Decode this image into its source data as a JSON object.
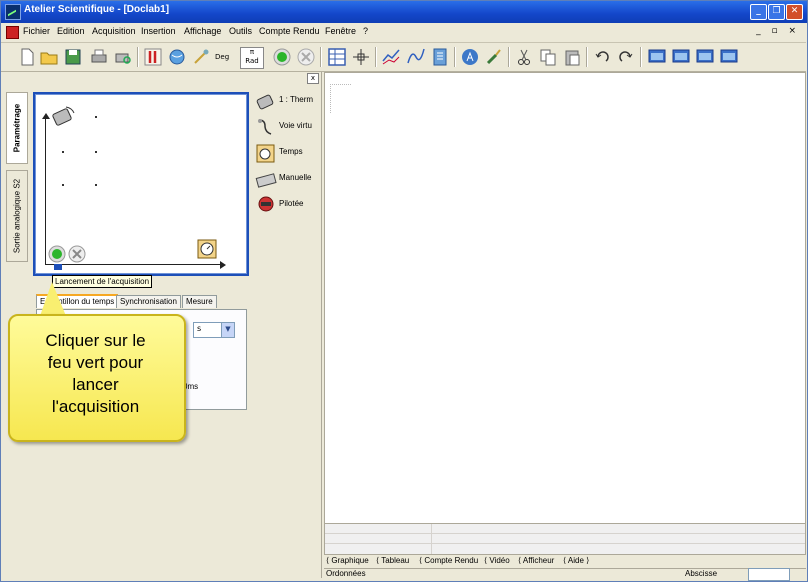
{
  "window": {
    "title": "Atelier Scientifique - [Doclab1]",
    "controls": [
      "_",
      "❐",
      "✕"
    ]
  },
  "menu": {
    "items": [
      "Fichier",
      "Edition",
      "Acquisition",
      "Insertion",
      "Affichage",
      "Outils",
      "Compte Rendu",
      "Fenêtre",
      "?"
    ],
    "mdi_controls": "_ ▫ ×"
  },
  "toolbar": {
    "deg_label": "Deg",
    "rad_label": "Rad",
    "pi_label": "π",
    "icons": [
      "new-icon",
      "open-icon",
      "save-icon",
      "print-icon",
      "print-preview-icon",
      "sensor-icon",
      "globe-icon",
      "wand-icon",
      "deg-icon",
      "rad-icon",
      "green-light-icon",
      "stop-icon",
      "table-icon",
      "cross-cursor-icon",
      "chart-icon",
      "curve-icon",
      "notebook-icon",
      "font-icon",
      "brush-icon",
      "cut-icon",
      "copy-icon",
      "paste-icon",
      "undo-icon",
      "redo-icon",
      "window1-icon",
      "window2-icon",
      "window3-icon",
      "window4-icon"
    ]
  },
  "left_panel": {
    "close_label": "x",
    "vertical_tabs": [
      "Paramétrage",
      "Sortie analogique S2"
    ],
    "sources": [
      {
        "label": "1 : Therm",
        "icon": "thermometer-sensor-icon"
      },
      {
        "label": "Voie virtu",
        "icon": "virtual-channel-icon"
      },
      {
        "label": "Temps",
        "icon": "stopwatch-icon"
      },
      {
        "label": "Manuelle",
        "icon": "keyboard-icon"
      },
      {
        "label": "Pilotée",
        "icon": "pilot-icon"
      }
    ],
    "tooltip": "Lancement de l'acquisition",
    "tabs": [
      "Echantillon du temps",
      "Synchronisation",
      "Mesure"
    ],
    "unit_value": "s",
    "duration_fragment": "0ms"
  },
  "callout": {
    "lines": [
      "Cliquer sur le",
      "feu vert pour",
      "lancer",
      "l'acquisition"
    ]
  },
  "bottom_tabs": [
    "Graphique",
    "Tableau",
    "Compte Rendu",
    "Vidéo",
    "Afficheur",
    "Aide"
  ],
  "status": {
    "left": "Ordonnées",
    "right": "Abscisse"
  }
}
